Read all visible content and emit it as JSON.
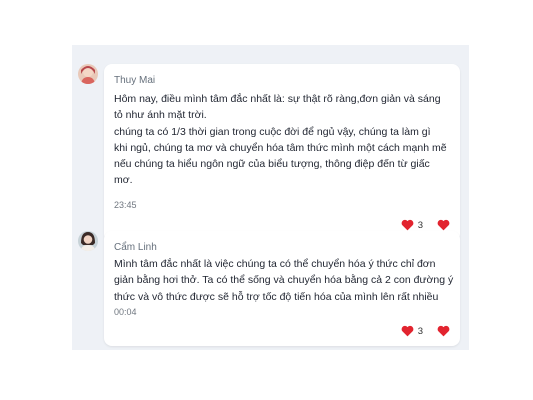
{
  "messages": [
    {
      "sender": "Thuy Mai",
      "lines": [
        "Hôm nay, điều mình tâm đắc nhất là: sự thật rõ ràng,đơn giản và  sáng",
        "tỏ như ánh mặt trời.",
        "chúng ta có 1/3 thời gian trong cuộc đời để ngủ vậy, chúng ta làm gì",
        "khi ngủ, chúng ta mơ và chuyển hóa tâm thức mình một cách mạnh mẽ",
        "nếu chúng ta hiểu ngôn ngữ của biểu tượng, thông điệp đến từ giấc",
        "mơ."
      ],
      "time": "23:45",
      "reaction_count": "3",
      "reaction_icon": "heart-icon",
      "avatar": "avatar-photo"
    },
    {
      "sender": "Cẩm Linh",
      "lines": [
        "Mình tâm đắc nhất là việc chúng ta có thể chuyển hóa ý thức chỉ đơn",
        "giản bằng hơi thở. Ta có thể sống và chuyển hóa bằng cả 2 con đường ý",
        "thức và vô thức được sẽ hỗ trợ tốc độ  tiến hóa của mình lên rất nhiều"
      ],
      "time": "00:04",
      "reaction_count": "3",
      "reaction_icon": "heart-icon",
      "avatar": "avatar-photo"
    }
  ],
  "colors": {
    "heart": "#e2242f",
    "panel": "#eef1f6",
    "bubble": "#ffffff"
  }
}
